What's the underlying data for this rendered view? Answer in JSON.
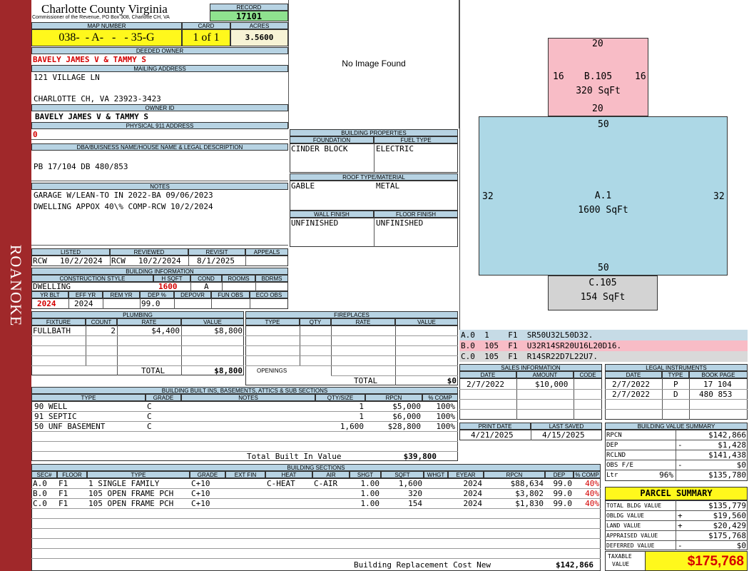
{
  "side_label": "ROANOKE",
  "header": {
    "county": "Charlotte County Virginia",
    "commissioner": "Commissioner of the Revenue, PO Box 308, Charlotte CH, VA",
    "record_label": "RECORD",
    "record": "17101",
    "map_label": "MAP NUMBER",
    "map_number": "038-  - A-   -   - 35-G",
    "card_label": "CARD",
    "card": "1 of 1",
    "acres_label": "ACRES",
    "acres": "3.5600"
  },
  "owner": {
    "deeded_label": "DEEDED OWNER",
    "deeded_owner": "BAVELY JAMES V & TAMMY S",
    "mailing_label": "MAILING ADDRESS",
    "mailing_line1": "121 VILLAGE LN",
    "mailing_line2": "",
    "mailing_line3": "CHARLOTTE CH, VA 23923-3423",
    "owner_id_label": "OWNER ID",
    "owner_id": "BAVELY JAMES V & TAMMY S",
    "physical_label": "PHYSICAL 911 ADDRESS",
    "physical_address": "0"
  },
  "legal": {
    "label": "DBA/BUISNESS NAME/HOUSE NAME & LEGAL DESCRIPTION",
    "text": "PB 17/104 DB 480/853"
  },
  "notes": {
    "label": "NOTES",
    "lines": [
      "GARAGE W/LEAN-TO IN 2022-BA 09/06/2023",
      "DWELLING APPOX 40\\% COMP-RCW 10/2/2024"
    ]
  },
  "photo": {
    "text": "No Image Found"
  },
  "building_properties": {
    "label": "BUILDING PROPERTIES",
    "foundation_label": "FOUNDATION",
    "fuel_label": "FUEL TYPE",
    "foundation": "CINDER BLOCK",
    "fuel": "ELECTRIC",
    "roof_label": "ROOF TYPE/MATERIAL",
    "roof_type": "GABLE",
    "roof_material": "METAL",
    "wall_label": "WALL FINISH",
    "floor_label": "FLOOR FINISH",
    "wall": "UNFINISHED",
    "floor": "UNFINISHED"
  },
  "review": {
    "listed_label": "LISTED",
    "reviewed_label": "REVIEWED",
    "revisit_label": "REVISIT",
    "appeals_label": "APPEALS",
    "listed_by": "RCW",
    "listed_date": "10/2/2024",
    "reviewed_by": "RCW",
    "reviewed_date": "10/2/2024",
    "revisit": "8/1/2025",
    "appeals": ""
  },
  "building_info": {
    "label": "BUILDING INFORMATION",
    "style_label": "CONSTRUCTION STYLE",
    "hsqft_label": "H SQFT",
    "cond_label": "COND",
    "rooms_label": "ROOMS",
    "bdrms_label": "BDRMS",
    "style": "DWELLING",
    "hsqft": "1600",
    "cond": "A",
    "rooms": "",
    "bdrms": "",
    "yrblt_label": "YR BLT",
    "effyr_label": "EFF YR",
    "remyr_label": "REM YR",
    "dep_label": "DEP %",
    "depovr_label": "DEPOVR",
    "funobs_label": "FUN OBS",
    "ecoobs_label": "ECO OBS",
    "yr_blt": "2024",
    "eff_yr": "2024",
    "rem_yr": "",
    "dep": "99.0",
    "depovr": "",
    "fun_obs": "",
    "eco_obs": ""
  },
  "plumbing": {
    "label": "PLUMBING",
    "columns": [
      "FIXTURE",
      "COUNT",
      "RATE",
      "VALUE"
    ],
    "rows": [
      {
        "fixture": "FULLBATH",
        "count": "2",
        "rate": "$4,400",
        "value": "$8,800"
      }
    ],
    "total_label": "TOTAL",
    "total": "$8,800"
  },
  "fireplaces": {
    "label": "FIREPLACES",
    "columns": [
      "TYPE",
      "QTY",
      "RATE",
      "VALUE"
    ],
    "openings_label": "OPENINGS",
    "total_label": "TOTAL",
    "total": "$0"
  },
  "sketch": {
    "areas": [
      {
        "label": "B.105",
        "sqft": "320 SqFt",
        "dims": [
          "20",
          "16",
          "16",
          "20"
        ],
        "color": "#f8bcc6"
      },
      {
        "label": "A.1",
        "sqft": "1600 SqFt",
        "dims": [
          "50",
          "32",
          "32",
          "50"
        ],
        "color": "#add8e6"
      },
      {
        "label": "C.105",
        "sqft": "154 SqFt",
        "color": "#d3d3d3"
      }
    ],
    "legend": [
      {
        "text": "A.0  1    F1  SR50U32L50D32.",
        "color": "#c6dbe6"
      },
      {
        "text": "B.0  105  F1  U32R14SR20U16L20D16.",
        "color": "#f8bcc6"
      },
      {
        "text": "C.0  105  F1  R14SR22D7L22U7.",
        "color": "#d9d9d9"
      }
    ]
  },
  "sales": {
    "label": "SALES INFORMATION",
    "columns": [
      "DATE",
      "AMOUNT",
      "CODE"
    ],
    "rows": [
      {
        "date": "2/7/2022",
        "amount": "$10,000",
        "code": ""
      }
    ]
  },
  "legal_instruments": {
    "label": "LEGAL INSTRUMENTS",
    "columns": [
      "DATE",
      "TYPE",
      "BOOK PAGE"
    ],
    "rows": [
      {
        "date": "2/7/2022",
        "type": "P",
        "book": "17 104"
      },
      {
        "date": "2/7/2022",
        "type": "D",
        "book": "480 853"
      }
    ]
  },
  "print_info": {
    "print_label": "PRINT DATE",
    "saved_label": "LAST SAVED",
    "print_date": "4/21/2025",
    "last_saved": "4/15/2025"
  },
  "built_ins": {
    "label": "BUILDING BUILT INS, BASEMENTS, ATTICS & SUB SECTIONS",
    "columns": [
      "TYPE",
      "GRADE",
      "NOTES",
      "QTY/SIZE",
      "RPCN",
      "% COMP"
    ],
    "rows": [
      {
        "type": "90 WELL",
        "grade": "C",
        "notes": "",
        "qty": "1",
        "rpcn": "$5,000",
        "comp": "100%"
      },
      {
        "type": "91 SEPTIC",
        "grade": "C",
        "notes": "",
        "qty": "1",
        "rpcn": "$6,000",
        "comp": "100%"
      },
      {
        "type": "50 UNF BASEMENT",
        "grade": "C",
        "notes": "",
        "qty": "1,600",
        "rpcn": "$28,800",
        "comp": "100%"
      }
    ],
    "total_label": "Total Built In Value",
    "total": "$39,800"
  },
  "value_summary": {
    "label": "BUILDING VALUE SUMMARY",
    "rows": [
      {
        "label": "RPCN",
        "sign": "",
        "value": "$142,866"
      },
      {
        "label": "DEP",
        "sign": "-",
        "value": "$1,428"
      },
      {
        "label": "RCLND",
        "sign": "",
        "value": "$141,438"
      },
      {
        "label": "OBS F/E",
        "sign": "-",
        "value": "$0"
      },
      {
        "label": "Ltr",
        "sign": "96%",
        "value": "$135,780"
      }
    ]
  },
  "parcel_summary": {
    "label": "PARCEL SUMMARY",
    "rows": [
      {
        "label": "TOTAL BLDG VALUE",
        "sign": "",
        "value": "$135,779"
      },
      {
        "label": "OBLDG VALUE",
        "sign": "+",
        "value": "$19,560"
      },
      {
        "label": "LAND VALUE",
        "sign": "+",
        "value": "$20,429"
      },
      {
        "label": "APPRAISED VALUE",
        "sign": "",
        "value": "$175,768"
      },
      {
        "label": "DEFERRED VALUE",
        "sign": "-",
        "value": "$0"
      }
    ],
    "taxable_label_1": "TAXABLE",
    "taxable_label_2": "VALUE",
    "taxable": "$175,768"
  },
  "sections": {
    "label": "BUILDING SECTIONS",
    "columns": [
      "SEC#",
      "FLOOR",
      "TYPE",
      "GRADE",
      "EXT FIN",
      "HEAT",
      "AIR",
      "SHGT",
      "SQFT",
      "WHGT",
      "EYEAR",
      "RPCN",
      "DEP",
      "% COMP"
    ],
    "rows": [
      {
        "sec": "A.0",
        "floor": "F1",
        "type": "1 SINGLE FAMILY",
        "grade": "C+10",
        "ext": "",
        "heat": "C-HEAT",
        "air": "C-AIR",
        "shgt": "1.00",
        "sqft": "1,600",
        "whgt": "",
        "eyear": "2024",
        "rpcn": "$88,634",
        "dep": "99.0",
        "comp": "40%"
      },
      {
        "sec": "B.0",
        "floor": "F1",
        "type": "105 OPEN FRAME PCH",
        "grade": "C+10",
        "ext": "",
        "heat": "",
        "air": "",
        "shgt": "1.00",
        "sqft": "320",
        "whgt": "",
        "eyear": "2024",
        "rpcn": "$3,802",
        "dep": "99.0",
        "comp": "40%"
      },
      {
        "sec": "C.0",
        "floor": "F1",
        "type": "105 OPEN FRAME PCH",
        "grade": "C+10",
        "ext": "",
        "heat": "",
        "air": "",
        "shgt": "1.00",
        "sqft": "154",
        "whgt": "",
        "eyear": "2024",
        "rpcn": "$1,830",
        "dep": "99.0",
        "comp": "40%"
      }
    ],
    "brcn_label": "Building Replacement Cost New",
    "brcn": "$142,866"
  }
}
